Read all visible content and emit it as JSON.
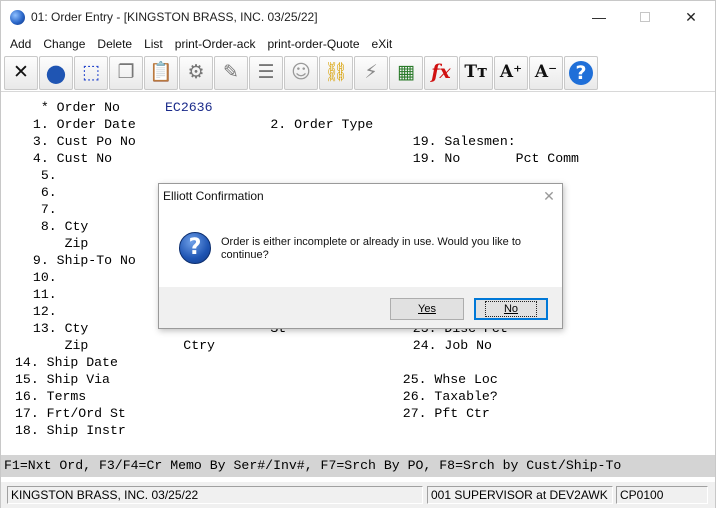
{
  "window": {
    "title": "01: Order Entry - [KINGSTON BRASS, INC. 03/25/22]",
    "min_glyph": "—",
    "close_glyph": "✕"
  },
  "menu": [
    "Add",
    "Change",
    "Delete",
    "List",
    "print-Order-ack",
    "print-order-Quote",
    "eXit"
  ],
  "toolbar": [
    {
      "icon": "close-x-icon",
      "glyph": "✕",
      "color": "#111111"
    },
    {
      "icon": "globe-icon",
      "glyph": "●",
      "color": "#1f55b3"
    },
    {
      "icon": "select-box-icon",
      "glyph": "⬚",
      "color": "#2244cc"
    },
    {
      "icon": "copy-icon",
      "glyph": "❐",
      "color": "#777777"
    },
    {
      "icon": "paste-icon",
      "glyph": "📋",
      "color": "#a07a2a"
    },
    {
      "icon": "gear-icon",
      "glyph": "⚙",
      "color": "#777777"
    },
    {
      "icon": "edit-icon",
      "glyph": "✎",
      "color": "#777777"
    },
    {
      "icon": "list-icon",
      "glyph": "☰",
      "color": "#777777"
    },
    {
      "icon": "users-icon",
      "glyph": "☺",
      "color": "#999999"
    },
    {
      "icon": "link-icon",
      "glyph": "⛓",
      "color": "#d8a000"
    },
    {
      "icon": "lightning-icon",
      "glyph": "⚡",
      "color": "#888888"
    },
    {
      "icon": "calculator-icon",
      "glyph": "▦",
      "color": "#2a7a2a"
    },
    {
      "icon": "function-icon",
      "glyph": "fx",
      "color": "#d01010"
    },
    {
      "icon": "font-size-icon",
      "glyph": "Tт",
      "color": "#111111"
    },
    {
      "icon": "font-increase-icon",
      "glyph": "A⁺",
      "color": "#111111"
    },
    {
      "icon": "font-decrease-icon",
      "glyph": "A⁻",
      "color": "#111111"
    },
    {
      "icon": "help-icon",
      "glyph": "?",
      "color": "#1f6fd8"
    }
  ],
  "screen": {
    "lines": [
      {
        "text": "  * Order No",
        "value": "EC2636"
      },
      {
        "text": " 1. Order Date                 2. Order Type"
      },
      {
        "text": " 3. Cust Po No                                   19. Salesmen:"
      },
      {
        "text": " 4. Cust No                                      19. No       Pct Comm"
      },
      {
        "text": "  5."
      },
      {
        "text": "  6.                                                              mm"
      },
      {
        "text": "  7."
      },
      {
        "text": "  8. Cty                                                          mm"
      },
      {
        "text": "     Zip"
      },
      {
        "text": " 9. Ship-To No"
      },
      {
        "text": " 10."
      },
      {
        "text": " 11."
      },
      {
        "text": " 12."
      },
      {
        "text": " 13. Cty                       St                23. Disc Pct"
      },
      {
        "text": "     Zip            Ctry                         24. Job No"
      },
      {
        "text": "14. Ship Date"
      },
      {
        "text": "15. Ship Via                                     25. Whse Loc"
      },
      {
        "text": "16. Terms                                        26. Taxable?"
      },
      {
        "text": "17. Frt/Ord St                                   27. Pft Ctr"
      },
      {
        "text": "18. Ship Instr"
      }
    ],
    "fkeys": "F1=Nxt Ord, F3/F4=Cr Memo By Ser#/Inv#, F7=Srch By PO, F8=Srch by Cust/Ship-To"
  },
  "status": {
    "company": "KINGSTON BRASS, INC. 03/25/22",
    "user": "001 SUPERVISOR at DEV2AWK",
    "program": "CP0100"
  },
  "dialog": {
    "title": "Elliott Confirmation",
    "close_glyph": "✕",
    "message": "Order is either incomplete or already in use.  Would you like to continue?",
    "yes_label": "Yes",
    "no_label": "No"
  }
}
